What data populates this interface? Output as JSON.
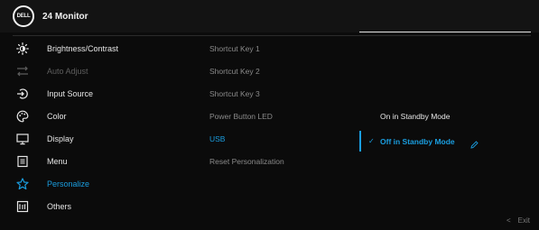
{
  "header": {
    "logo_text": "DELL",
    "title": "24 Monitor"
  },
  "menu": {
    "items": [
      {
        "label": "Brightness/Contrast",
        "icon": "brightness-icon"
      },
      {
        "label": "Auto Adjust",
        "icon": "auto-adjust-icon"
      },
      {
        "label": "Input Source",
        "icon": "input-source-icon"
      },
      {
        "label": "Color",
        "icon": "color-palette-icon"
      },
      {
        "label": "Display",
        "icon": "display-icon"
      },
      {
        "label": "Menu",
        "icon": "menu-icon"
      },
      {
        "label": "Personalize",
        "icon": "star-icon"
      },
      {
        "label": "Others",
        "icon": "others-icon"
      }
    ]
  },
  "submenu": {
    "items": [
      {
        "label": "Shortcut Key 1"
      },
      {
        "label": "Shortcut Key 2"
      },
      {
        "label": "Shortcut Key 3"
      },
      {
        "label": "Power Button LED"
      },
      {
        "label": "USB"
      },
      {
        "label": "Reset Personalization"
      }
    ]
  },
  "options": {
    "on_standby": "On in Standby Mode",
    "off_standby": "Off in Standby Mode"
  },
  "footer": {
    "exit_label": "Exit"
  },
  "colors": {
    "accent": "#1a9ee0",
    "background": "#0b0b0b",
    "header": "#131313"
  }
}
